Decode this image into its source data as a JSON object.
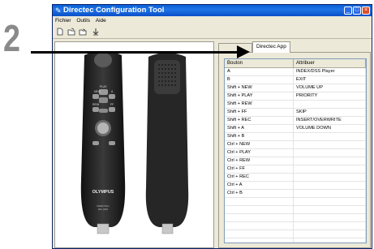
{
  "step_number": "2",
  "window": {
    "title": "Directec Configuration Tool",
    "controls": {
      "minimize": "_",
      "maximize": "□",
      "close": "×"
    }
  },
  "menu": [
    "Fichier",
    "Outils",
    "Aide"
  ],
  "toolbar_icons": [
    "new-icon",
    "open-icon",
    "save-icon",
    "download-icon"
  ],
  "device": {
    "front_labels": [
      "NEW",
      "PLAY",
      "A",
      "REW",
      "FF"
    ],
    "brand": "OLYMPUS",
    "model_line1": "DIRECTEC",
    "model_line2": "DR-1000"
  },
  "tabs": {
    "inactive": "",
    "active": "Directec App"
  },
  "table": {
    "headers": [
      "Bouton",
      "Attribuer"
    ],
    "rows": [
      [
        "A",
        "INDEX/DSS Player"
      ],
      [
        "B",
        "EXIT"
      ],
      [
        "Shift + NEW",
        "VOLUME UP"
      ],
      [
        "Shift + PLAY",
        "PRIORITY"
      ],
      [
        "Shift + REW",
        ""
      ],
      [
        "Shift + FF",
        "SKIP"
      ],
      [
        "Shift + REC",
        "INSERT/OVERWRITE"
      ],
      [
        "Shift + A",
        "VOLUME DOWN"
      ],
      [
        "Shift + B",
        ""
      ],
      [
        "Ctrl + NEW",
        ""
      ],
      [
        "Ctrl + PLAY",
        ""
      ],
      [
        "Ctrl + REW",
        ""
      ],
      [
        "Ctrl + FF",
        ""
      ],
      [
        "Ctrl + REC",
        ""
      ],
      [
        "Ctrl + A",
        ""
      ],
      [
        "Ctrl + B",
        ""
      ],
      [
        "",
        ""
      ],
      [
        "",
        ""
      ],
      [
        "",
        ""
      ],
      [
        "",
        ""
      ],
      [
        "",
        ""
      ],
      [
        "",
        ""
      ]
    ]
  },
  "colors": {
    "titlebar": "#0a5ed6",
    "window_bg": "#ece9d8",
    "device_body": "#2b2b2b"
  }
}
